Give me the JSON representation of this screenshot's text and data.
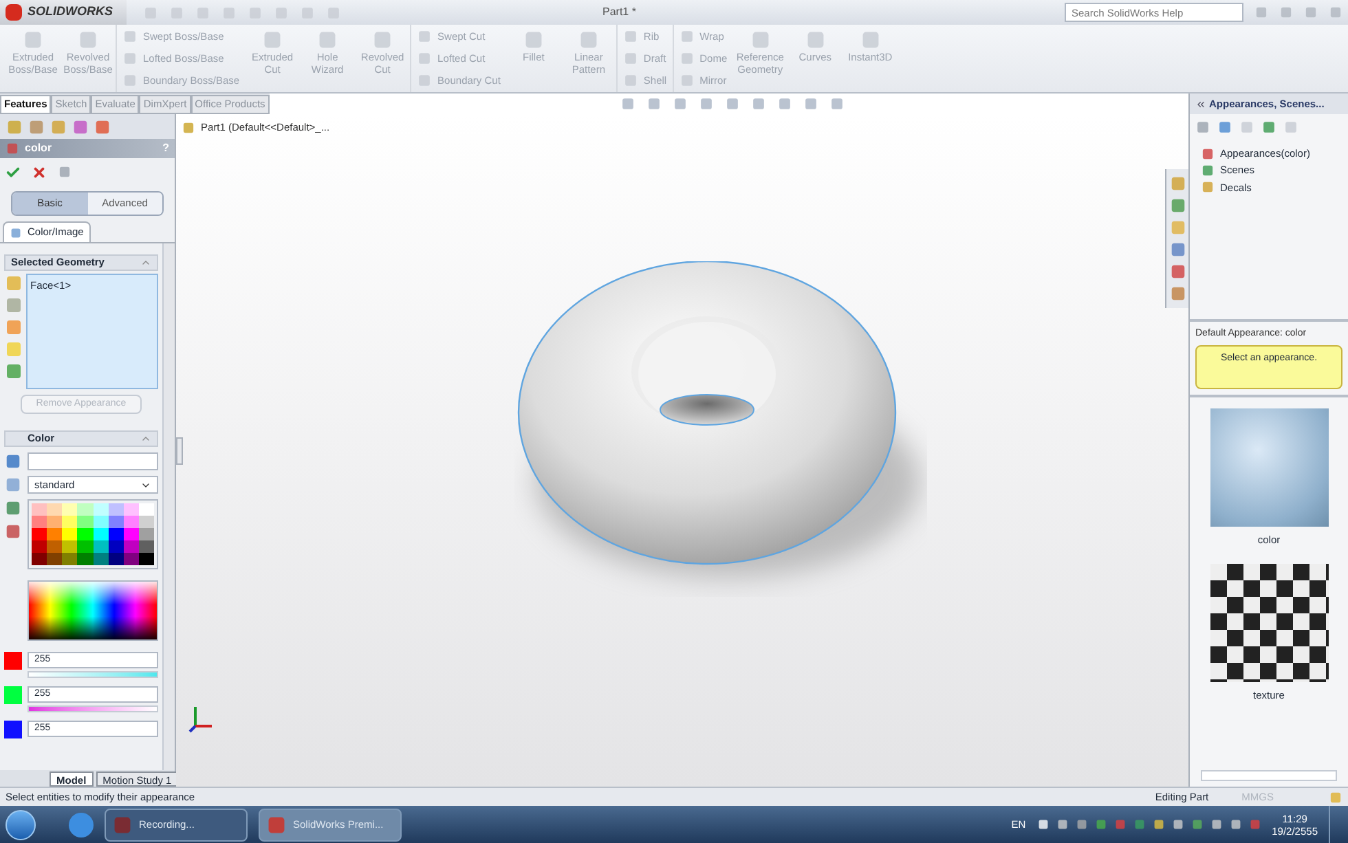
{
  "title_bar": {
    "logo": "SOLIDWORKS",
    "title": "Part1 *",
    "search": {
      "placeholder": "Search SolidWorks Help"
    }
  },
  "ribbon": [
    {
      "kind": "big",
      "disabled": true,
      "items": [
        "Extruded Boss/Base"
      ]
    },
    {
      "kind": "big",
      "disabled": true,
      "items": [
        "Revolved Boss/Base"
      ]
    },
    {
      "kind": "stack",
      "disabled": true,
      "items": [
        "Swept Boss/Base",
        "Lofted Boss/Base",
        "Boundary Boss/Base"
      ]
    },
    {
      "kind": "big",
      "disabled": true,
      "items": [
        "Extruded Cut"
      ]
    },
    {
      "kind": "big",
      "disabled": true,
      "items": [
        "Hole Wizard"
      ]
    },
    {
      "kind": "big",
      "disabled": true,
      "items": [
        "Revolved Cut"
      ]
    },
    {
      "kind": "stack",
      "disabled": true,
      "items": [
        "Swept Cut",
        "Lofted Cut",
        "Boundary Cut"
      ]
    },
    {
      "kind": "big",
      "disabled": true,
      "items": [
        "Fillet"
      ]
    },
    {
      "kind": "big",
      "disabled": true,
      "items": [
        "Linear Pattern"
      ]
    },
    {
      "kind": "stack",
      "disabled": true,
      "items": [
        "Rib",
        "Draft",
        "Shell"
      ]
    },
    {
      "kind": "stack",
      "disabled": true,
      "items": [
        "Wrap",
        "Dome",
        "Mirror"
      ]
    },
    {
      "kind": "big",
      "disabled": true,
      "items": [
        "Reference Geometry"
      ]
    },
    {
      "kind": "big",
      "disabled": true,
      "items": [
        "Curves"
      ]
    },
    {
      "kind": "big",
      "disabled": true,
      "items": [
        "Instant3D"
      ]
    }
  ],
  "command_tabs": [
    {
      "label": "Features",
      "selected": true
    },
    {
      "label": "Sketch",
      "selected": false
    },
    {
      "label": "Evaluate",
      "selected": false
    },
    {
      "label": "DimXpert",
      "selected": false
    },
    {
      "label": "Office Products",
      "selected": false
    }
  ],
  "feature_tree": {
    "root": "Part1  (Default<<Default>_..."
  },
  "property_manager": {
    "title": "color",
    "help": "?",
    "modes": [
      {
        "label": "Basic",
        "selected": true
      },
      {
        "label": "Advanced",
        "selected": false
      }
    ],
    "tab": "Color/Image",
    "selected_geometry": {
      "title": "Selected Geometry",
      "items": [
        "Face<1>"
      ],
      "button": {
        "label": "Remove Appearance",
        "disabled": true
      }
    },
    "color": {
      "title": "Color",
      "palette": "standard",
      "channels": [
        {
          "value": "255",
          "color": "#ff0000",
          "level": 1
        },
        {
          "value": "255",
          "color": "#00ff40",
          "level": 1
        },
        {
          "value": "255",
          "color": "#1010ff"
        }
      ]
    }
  },
  "task_pane": {
    "title": "Appearances, Scenes...",
    "tree": [
      "Appearances(color)",
      "Scenes",
      "Decals"
    ],
    "default_label": "Default Appearance: color",
    "tip": "Select an appearance.",
    "thumbnails": [
      {
        "label": "color",
        "kind": "glossy"
      },
      {
        "label": "texture",
        "kind": "checker"
      }
    ]
  },
  "bottom_tabs": [
    {
      "label": "Model",
      "selected": true
    },
    {
      "label": "Motion Study 1",
      "selected": false
    }
  ],
  "status_bar": {
    "message": "Select entities to modify their appearance",
    "mode": "Editing Part",
    "units": "MMGS"
  },
  "taskbar": {
    "tasks": [
      "Recording...",
      "SolidWorks Premi..."
    ],
    "language": "EN",
    "time": "11:29",
    "date": "19/2/2555"
  }
}
